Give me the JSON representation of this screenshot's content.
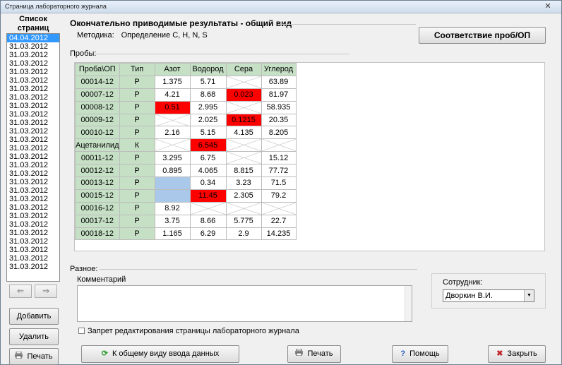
{
  "window": {
    "title": "Страница лабораторного журнала",
    "close_glyph": "✕"
  },
  "sidebar": {
    "title": "Список страниц",
    "dates": [
      "04.04.2012",
      "31.03.2012",
      "31.03.2012",
      "31.03.2012",
      "31.03.2012",
      "31.03.2012",
      "31.03.2012",
      "31.03.2012",
      "31.03.2012",
      "31.03.2012",
      "31.03.2012",
      "31.03.2012",
      "31.03.2012",
      "31.03.2012",
      "31.03.2012",
      "31.03.2012",
      "31.03.2012",
      "31.03.2012",
      "31.03.2012",
      "31.03.2012",
      "31.03.2012",
      "31.03.2012",
      "31.03.2012",
      "31.03.2012",
      "31.03.2012",
      "31.03.2012",
      "31.03.2012",
      "31.03.2012"
    ],
    "selected_index": 0,
    "prev_glyph": "⇐",
    "next_glyph": "⇒",
    "add_label": "Добавить",
    "delete_label": "Удалить",
    "print_label": "Печать"
  },
  "main": {
    "heading": "Окончательно приводимые результаты - общий вид",
    "method_label": "Методика:",
    "method_value": "Определение C, H, N, S",
    "match_button": "Соответствие проб/ОП",
    "samples_label": "Пробы:",
    "columns": [
      "Проба\\ОП",
      "Тип",
      "Азот",
      "Водород",
      "Сера",
      "Углерод"
    ],
    "rows": [
      {
        "name": "00014-12",
        "type": "Р",
        "cells": [
          {
            "v": "1.375"
          },
          {
            "v": "5.71"
          },
          {
            "v": "",
            "s": "x"
          },
          {
            "v": "63.89"
          }
        ]
      },
      {
        "name": "00007-12",
        "type": "Р",
        "cells": [
          {
            "v": "4.21"
          },
          {
            "v": "8.68"
          },
          {
            "v": "0.023",
            "s": "red"
          },
          {
            "v": "81.97"
          }
        ]
      },
      {
        "name": "00008-12",
        "type": "Р",
        "cells": [
          {
            "v": "0.51",
            "s": "red"
          },
          {
            "v": "2.995"
          },
          {
            "v": "",
            "s": "x"
          },
          {
            "v": "58.935"
          }
        ]
      },
      {
        "name": "00009-12",
        "type": "Р",
        "cells": [
          {
            "v": "",
            "s": "x"
          },
          {
            "v": "2.025"
          },
          {
            "v": "0.1215",
            "s": "red"
          },
          {
            "v": "20.35"
          }
        ]
      },
      {
        "name": "00010-12",
        "type": "Р",
        "cells": [
          {
            "v": "2.16"
          },
          {
            "v": "5.15"
          },
          {
            "v": "4.135"
          },
          {
            "v": "8.205"
          }
        ]
      },
      {
        "name": "Ацетанилид",
        "type": "К",
        "cells": [
          {
            "v": "",
            "s": "x"
          },
          {
            "v": "6.545",
            "s": "red"
          },
          {
            "v": "",
            "s": "x"
          },
          {
            "v": "",
            "s": "x"
          }
        ]
      },
      {
        "name": "00011-12",
        "type": "Р",
        "cells": [
          {
            "v": "3.295"
          },
          {
            "v": "6.75"
          },
          {
            "v": "",
            "s": "x"
          },
          {
            "v": "15.12"
          }
        ]
      },
      {
        "name": "00012-12",
        "type": "Р",
        "cells": [
          {
            "v": "0.895"
          },
          {
            "v": "4.065"
          },
          {
            "v": "8.815"
          },
          {
            "v": "77.72"
          }
        ]
      },
      {
        "name": "00013-12",
        "type": "Р",
        "cells": [
          {
            "v": "",
            "s": "blue"
          },
          {
            "v": "0.34"
          },
          {
            "v": "3.23"
          },
          {
            "v": "71.5"
          }
        ]
      },
      {
        "name": "00015-12",
        "type": "Р",
        "cells": [
          {
            "v": "",
            "s": "blue"
          },
          {
            "v": "11.45",
            "s": "red"
          },
          {
            "v": "2.305"
          },
          {
            "v": "79.2"
          }
        ]
      },
      {
        "name": "00016-12",
        "type": "Р",
        "cells": [
          {
            "v": "8.92"
          },
          {
            "v": "",
            "s": "x"
          },
          {
            "v": "",
            "s": "x"
          },
          {
            "v": "",
            "s": "x"
          }
        ]
      },
      {
        "name": "00017-12",
        "type": "Р",
        "cells": [
          {
            "v": "3.75"
          },
          {
            "v": "8.66"
          },
          {
            "v": "5.775"
          },
          {
            "v": "22.7"
          }
        ]
      },
      {
        "name": "00018-12",
        "type": "Р",
        "cells": [
          {
            "v": "1.165"
          },
          {
            "v": "6.29"
          },
          {
            "v": "2.9"
          },
          {
            "v": "14.235"
          }
        ]
      }
    ],
    "misc_label": "Разное:",
    "comment_label": "Комментарий",
    "comment_value": "",
    "employee_label": "Сотрудник:",
    "employee_value": "Дворкин В.И.",
    "lock_label": "Запрет редактирования страницы лабораторного журнала"
  },
  "footer": {
    "back_label": "К общему виду ввода данных",
    "print_label": "Печать",
    "help_label": "Помощь",
    "close_label": "Закрыть"
  },
  "colors": {
    "header_green": "#c6e0c6",
    "error_red": "#ff0000",
    "missing_blue": "#a9c8ea",
    "selection": "#3399ff"
  }
}
